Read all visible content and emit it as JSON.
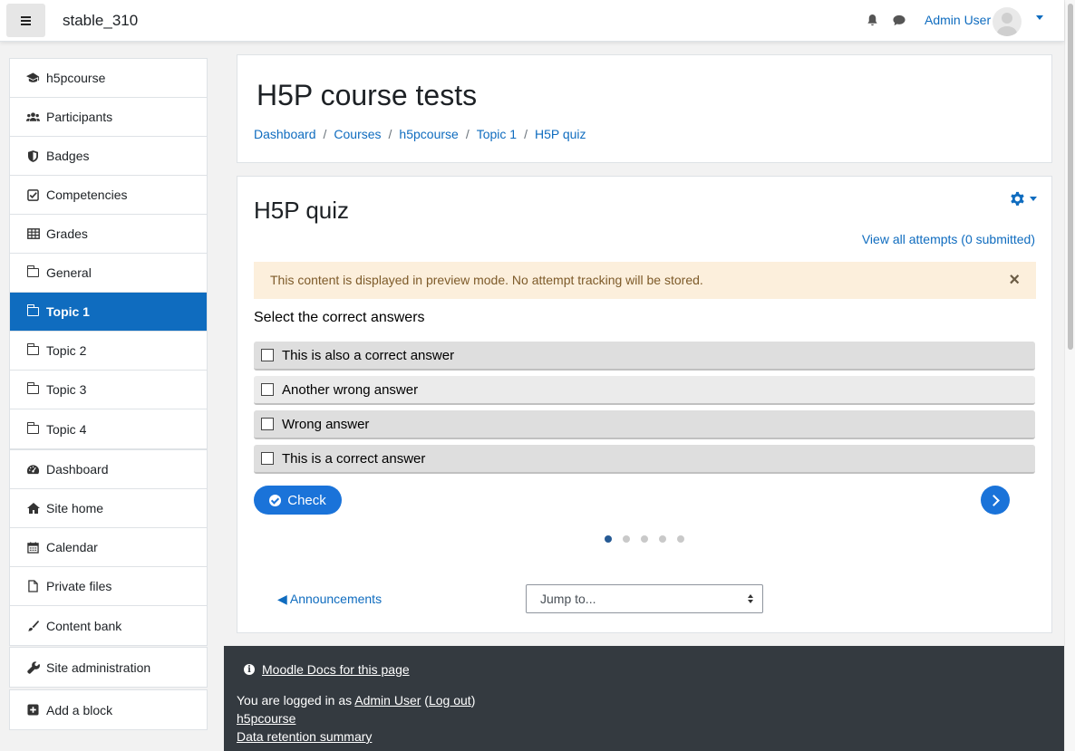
{
  "navbar": {
    "site_name": "stable_310",
    "user_name": "Admin User"
  },
  "sidebar": {
    "course_items": [
      {
        "label": "h5pcourse",
        "icon": "graduation-cap-icon"
      },
      {
        "label": "Participants",
        "icon": "users-icon"
      },
      {
        "label": "Badges",
        "icon": "shield-icon"
      },
      {
        "label": "Competencies",
        "icon": "check-square-icon"
      },
      {
        "label": "Grades",
        "icon": "table-icon"
      },
      {
        "label": "General",
        "icon": "folder-icon"
      },
      {
        "label": "Topic 1",
        "icon": "folder-icon",
        "active": true
      },
      {
        "label": "Topic 2",
        "icon": "folder-icon"
      },
      {
        "label": "Topic 3",
        "icon": "folder-icon"
      },
      {
        "label": "Topic 4",
        "icon": "folder-icon"
      }
    ],
    "site_items": [
      {
        "label": "Dashboard",
        "icon": "dashboard-icon"
      },
      {
        "label": "Site home",
        "icon": "home-icon"
      },
      {
        "label": "Calendar",
        "icon": "calendar-icon"
      },
      {
        "label": "Private files",
        "icon": "file-icon"
      },
      {
        "label": "Content bank",
        "icon": "paint-brush-icon"
      }
    ],
    "admin_item": {
      "label": "Site administration",
      "icon": "wrench-icon"
    },
    "add_block": {
      "label": "Add a block",
      "icon": "plus-square-icon"
    }
  },
  "header": {
    "title": "H5P course tests",
    "breadcrumb": [
      "Dashboard",
      "Courses",
      "h5pcourse",
      "Topic 1",
      "H5P quiz"
    ]
  },
  "activity": {
    "title": "H5P quiz",
    "view_attempts": "View all attempts (0 submitted)",
    "alert": "This content is displayed in preview mode. No attempt tracking will be stored.",
    "question": "Select the correct answers",
    "answers": [
      "This is also a correct answer",
      "Another wrong answer",
      "Wrong answer",
      "This is a correct answer"
    ],
    "check_label": "Check",
    "page_count": 5,
    "current_page": 1
  },
  "nav": {
    "prev_label": "◀ Announcements",
    "jump_placeholder": "Jump to..."
  },
  "footer": {
    "docs_link": "Moodle Docs for this page",
    "logged_prefix": "You are logged in as ",
    "logged_user": "Admin User",
    "logout": "Log out",
    "course_link": "h5pcourse",
    "retention_link": "Data retention summary"
  },
  "colors": {
    "accent": "#0f6cbf",
    "h5p_blue": "#1a73d9",
    "alert_bg": "#fcefdc",
    "footer_bg": "#343a40"
  }
}
